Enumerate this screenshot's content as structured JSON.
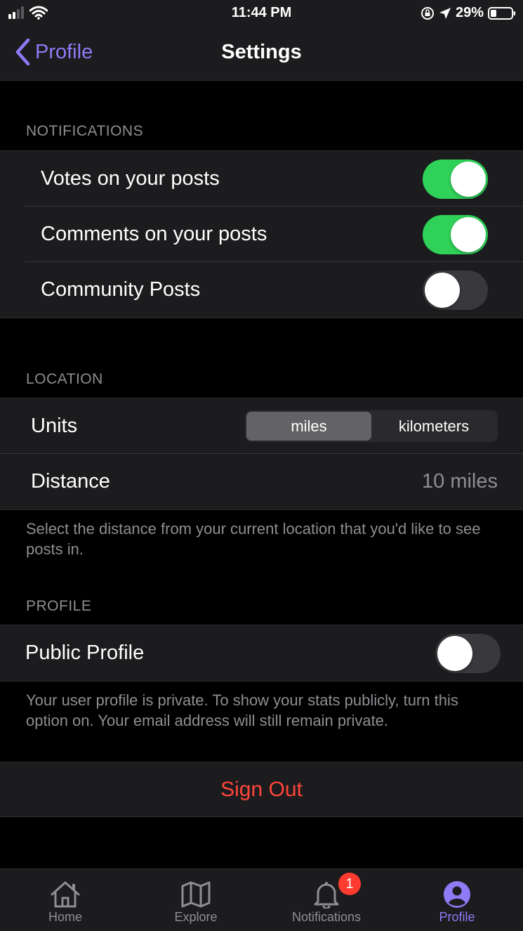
{
  "status_bar": {
    "time": "11:44 PM",
    "battery": "29%"
  },
  "nav": {
    "back_label": "Profile",
    "title": "Settings"
  },
  "notifications": {
    "header": "NOTIFICATIONS",
    "items": [
      {
        "label": "Votes on your posts",
        "on": true
      },
      {
        "label": "Comments on your posts",
        "on": true
      },
      {
        "label": "Community Posts",
        "on": false
      }
    ]
  },
  "location": {
    "header": "LOCATION",
    "units_label": "Units",
    "units_options": [
      "miles",
      "kilometers"
    ],
    "units_selected": "miles",
    "distance_label": "Distance",
    "distance_value": "10 miles",
    "footnote": "Select the distance from your current location that you'd like to see posts in."
  },
  "profile": {
    "header": "PROFILE",
    "public_label": "Public Profile",
    "public_on": false,
    "footnote": "Your user profile is private. To show your stats publicly, turn this option on. Your email address will still remain private."
  },
  "signout_label": "Sign Out",
  "tabs": [
    {
      "label": "Home",
      "icon": "home-icon"
    },
    {
      "label": "Explore",
      "icon": "map-icon"
    },
    {
      "label": "Notifications",
      "icon": "bell-icon",
      "badge": "1"
    },
    {
      "label": "Profile",
      "icon": "person-icon",
      "active": true
    }
  ],
  "colors": {
    "accent": "#8e7bf6",
    "toggle_on": "#30d158",
    "destructive": "#ff453a",
    "badge": "#ff3b30"
  }
}
